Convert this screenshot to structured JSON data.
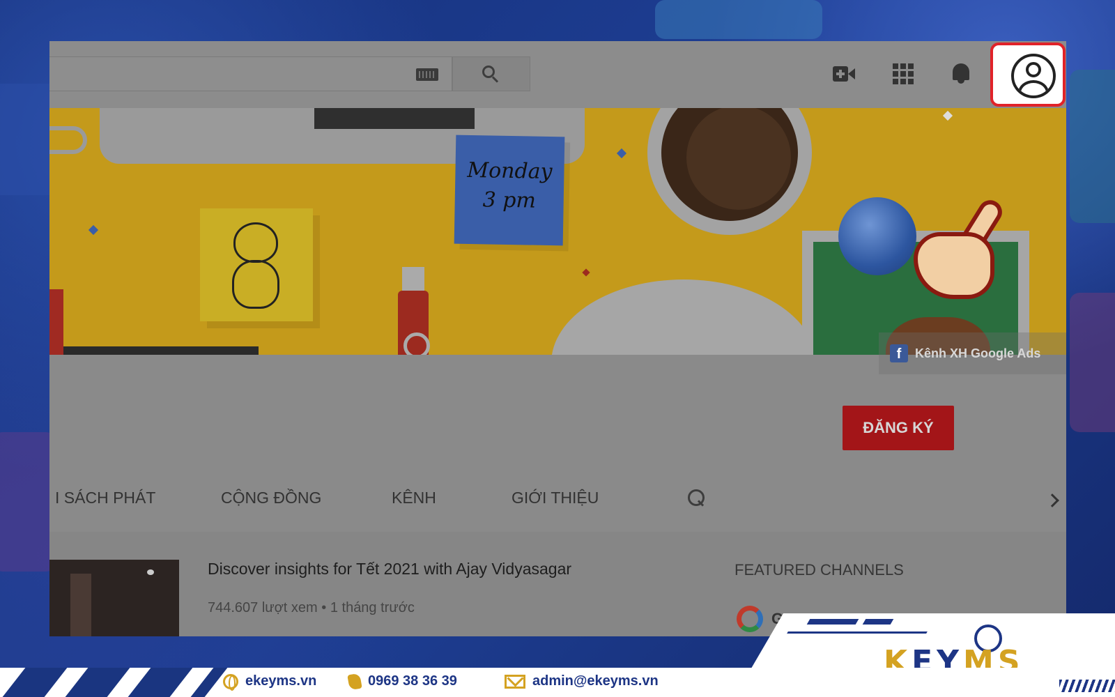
{
  "header": {
    "search_placeholder": "",
    "icons": [
      "keyboard-icon",
      "search-icon",
      "create-video-icon",
      "apps-icon",
      "notifications-icon",
      "account-icon"
    ],
    "highlight_color": "#e12229"
  },
  "banner": {
    "note_text_line1": "Monday",
    "note_text_line2": "3 pm",
    "social_label": "Kênh XH Google Ads"
  },
  "channel": {
    "subscribe_label": "ĐĂNG KÝ",
    "subscribe_color": "#a31518"
  },
  "tabs": [
    {
      "label": "I SÁCH PHÁT"
    },
    {
      "label": "CỘNG ĐỒNG"
    },
    {
      "label": "KÊNH"
    },
    {
      "label": "GIỚI THIỆU"
    }
  ],
  "video": {
    "title": "Discover insights for Tết 2021 with Ajay Vidyasagar",
    "views": "744.607 lượt xem",
    "age": "1 tháng trước"
  },
  "sidebar": {
    "featured_heading": "FEATURED CHANNELS",
    "first_channel_initial": "G"
  },
  "footer": {
    "website": "ekeyms.vn",
    "phone": "0969 38 36 39",
    "email": "admin@ekeyms.vn",
    "logo_k": "K",
    "logo_ey": "EY",
    "logo_ms": "MS",
    "brand_gold": "#d4a221",
    "brand_blue": "#1d3585"
  }
}
